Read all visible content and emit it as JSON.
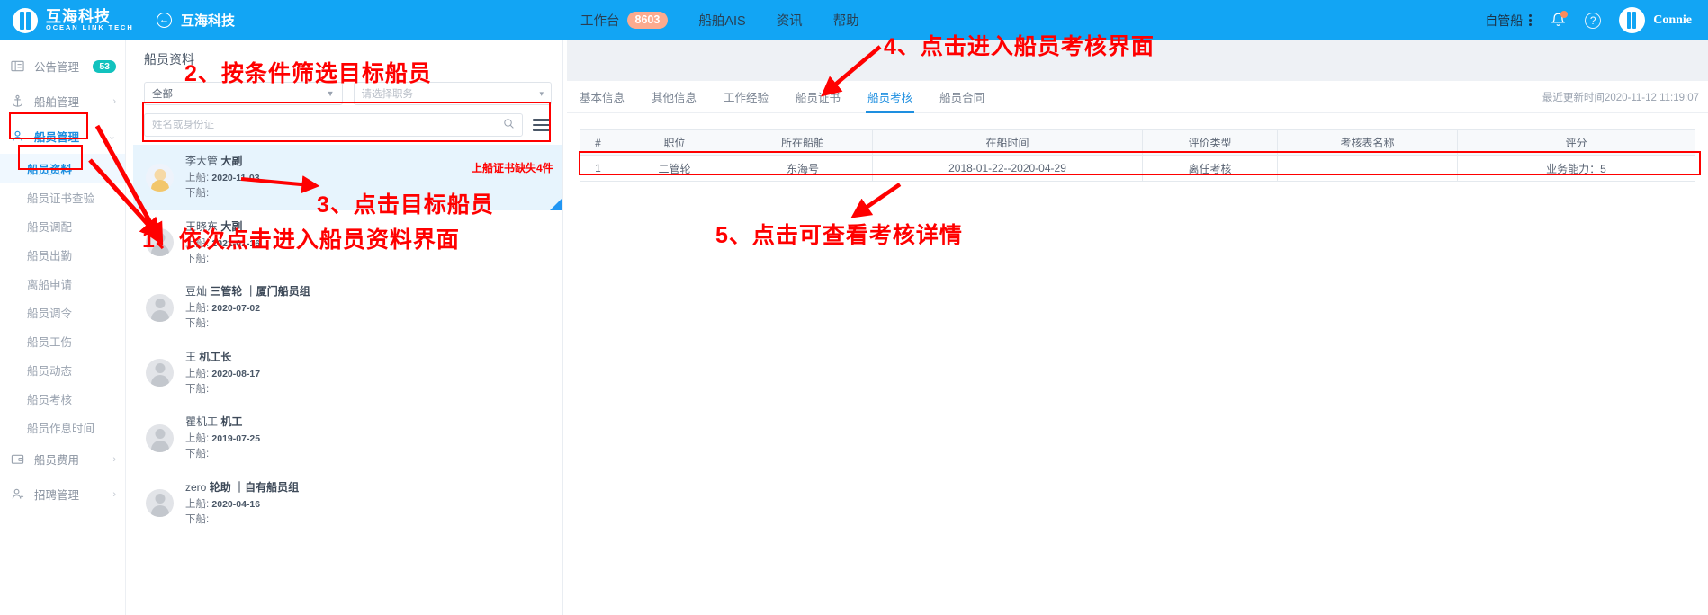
{
  "topbar": {
    "brand_cn": "互海科技",
    "brand_en": "OCEAN LINK TECH",
    "back_title": "互海科技",
    "back_icon": "arrow-left-circle-icon",
    "links": [
      {
        "label": "工作台",
        "badge": "8603"
      },
      {
        "label": "船舶AIS",
        "badge": ""
      },
      {
        "label": "资讯",
        "badge": ""
      },
      {
        "label": "帮助",
        "badge": ""
      }
    ],
    "vessel_selector": "自管船",
    "user_name": "Connie"
  },
  "sidebar": {
    "items": [
      {
        "label": "公告管理",
        "icon": "announce-icon",
        "badge": "53",
        "arrow": "",
        "active": false
      },
      {
        "label": "船舶管理",
        "icon": "anchor-icon",
        "badge": "",
        "arrow": "›",
        "active": false
      },
      {
        "label": "船员管理",
        "icon": "user-icon",
        "badge": "",
        "arrow": "⌄",
        "active": true
      }
    ],
    "sub_items": [
      {
        "label": "船员资料",
        "active": true
      },
      {
        "label": "船员证书查验",
        "active": false
      },
      {
        "label": "船员调配",
        "active": false
      },
      {
        "label": "船员出勤",
        "active": false
      },
      {
        "label": "离船申请",
        "active": false
      },
      {
        "label": "船员调令",
        "active": false
      },
      {
        "label": "船员工伤",
        "active": false
      },
      {
        "label": "船员动态",
        "active": false
      },
      {
        "label": "船员考核",
        "active": false
      },
      {
        "label": "船员作息时间",
        "active": false
      }
    ],
    "bottom_items": [
      {
        "label": "船员费用",
        "icon": "wallet-icon",
        "arrow": "›"
      },
      {
        "label": "招聘管理",
        "icon": "user-plus-icon",
        "arrow": "›"
      }
    ]
  },
  "crew_panel": {
    "title": "船员资料",
    "filter_ship": "全部",
    "filter_position_placeholder": "请选择职务",
    "search_placeholder": "姓名或身份证",
    "search_value": "",
    "search_icon": "magnifier-icon",
    "list_icon": "list-view-icon",
    "board_label": "上船:",
    "disembark_label": "下船:",
    "list": [
      {
        "name": "李大管",
        "role": "大副",
        "group": "",
        "board": "2020-11-03",
        "disembark": "",
        "selected": true,
        "has_photo": true
      },
      {
        "name": "王晓东",
        "role": "大副",
        "group": "",
        "board": "2021-01-16",
        "disembark": "",
        "selected": false,
        "has_photo": false
      },
      {
        "name": "豆灿",
        "role": "三管轮",
        "group": "厦门船员组",
        "board": "2020-07-02",
        "disembark": "",
        "selected": false,
        "has_photo": false
      },
      {
        "name": "王",
        "role": "机工长",
        "group": "",
        "board": "2020-08-17",
        "disembark": "",
        "selected": false,
        "has_photo": false
      },
      {
        "name": "瞿机工",
        "role": "机工",
        "group": "",
        "board": "2019-07-25",
        "disembark": "",
        "selected": false,
        "has_photo": false
      },
      {
        "name": "zero",
        "role": "轮助",
        "group": "自有船员组",
        "board": "2020-04-16",
        "disembark": "",
        "selected": false,
        "has_photo": false
      }
    ]
  },
  "detail": {
    "tabs": [
      {
        "label": "基本信息",
        "active": false
      },
      {
        "label": "其他信息",
        "active": false
      },
      {
        "label": "工作经验",
        "active": false
      },
      {
        "label": "船员证书",
        "active": false
      },
      {
        "label": "船员考核",
        "active": true
      },
      {
        "label": "船员合同",
        "active": false
      }
    ],
    "updated_text": "最近更新时间2020-11-12 11:19:07",
    "table": {
      "headers": [
        "#",
        "职位",
        "所在船舶",
        "在船时间",
        "评价类型",
        "考核表名称",
        "评分"
      ],
      "rows": [
        [
          "1",
          "二管轮",
          "东海号",
          "2018-01-22--2020-04-29",
          "离任考核",
          "",
          "业务能力：5"
        ]
      ]
    }
  },
  "annotations": {
    "cert_missing": "上船证书缺失4件",
    "step1": "1、依次点击进入船员资料界面",
    "step2": "2、按条件筛选目标船员",
    "step3": "3、点击目标船员",
    "step4": "4、点击进入船员考核界面",
    "step5": "5、点击可查看考核详情"
  },
  "colors": {
    "brand_blue": "#12A5F4",
    "accent_blue": "#1E8FE0",
    "badge_orange": "#FCAB8F",
    "badge_teal": "#12C2BE",
    "annotation_red": "#FF0000"
  }
}
